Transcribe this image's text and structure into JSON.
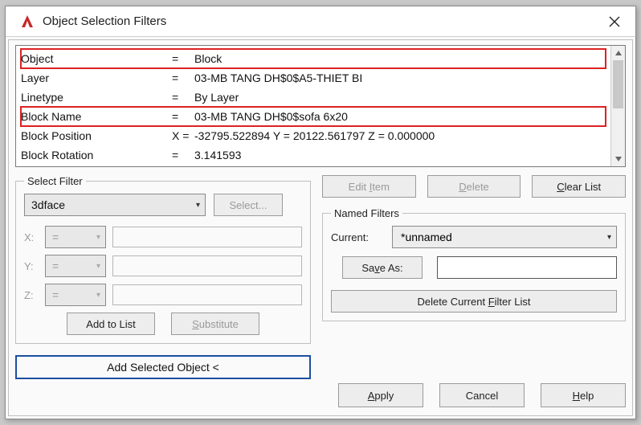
{
  "window": {
    "title": "Object Selection Filters"
  },
  "list": {
    "rows": [
      {
        "c1": "Object",
        "c2": "=",
        "c3": "Block",
        "hl": true
      },
      {
        "c1": "Layer",
        "c2": "=",
        "c3": "03-MB TANG DH$0$A5-THIET BI",
        "hl": false
      },
      {
        "c1": "Linetype",
        "c2": "=",
        "c3": "By Layer",
        "hl": false
      },
      {
        "c1": "Block Name",
        "c2": "=",
        "c3": "03-MB TANG DH$0$sofa 6x20",
        "hl": true
      },
      {
        "c1": "Block Position",
        "c2": "X  =",
        "c3": "-32795.522894       Y  =  20122.561797       Z  =  0.000000",
        "hl": false
      },
      {
        "c1": "Block Rotation",
        "c2": "=",
        "c3": "3.141593",
        "hl": false
      }
    ]
  },
  "select_filter": {
    "legend": "Select Filter",
    "combo": "3dface",
    "select_btn": "Select...",
    "x_label": "X:",
    "y_label": "Y:",
    "z_label": "Z:",
    "op": "=",
    "add_to_list": "Add to List",
    "substitute_u": "S",
    "substitute_rest": "ubstitute",
    "add_selected": "Add Selected Object <"
  },
  "right": {
    "edit_item_pre": "Edit ",
    "edit_item_u": "I",
    "edit_item_post": "tem",
    "delete_u": "D",
    "delete_rest": "elete",
    "clear_u": "C",
    "clear_rest": "lear List",
    "named_legend": "Named Filters",
    "current_label": "Current:",
    "current_value": "*unnamed",
    "save_as_pre": "Sa",
    "save_as_u": "v",
    "save_as_post": "e As:",
    "save_as_value": "",
    "delete_cur_pre": "Delete Current ",
    "delete_cur_u": "F",
    "delete_cur_post": "ilter List",
    "apply_u": "A",
    "apply_rest": "pply",
    "cancel": "Cancel",
    "help_u": "H",
    "help_rest": "elp"
  }
}
